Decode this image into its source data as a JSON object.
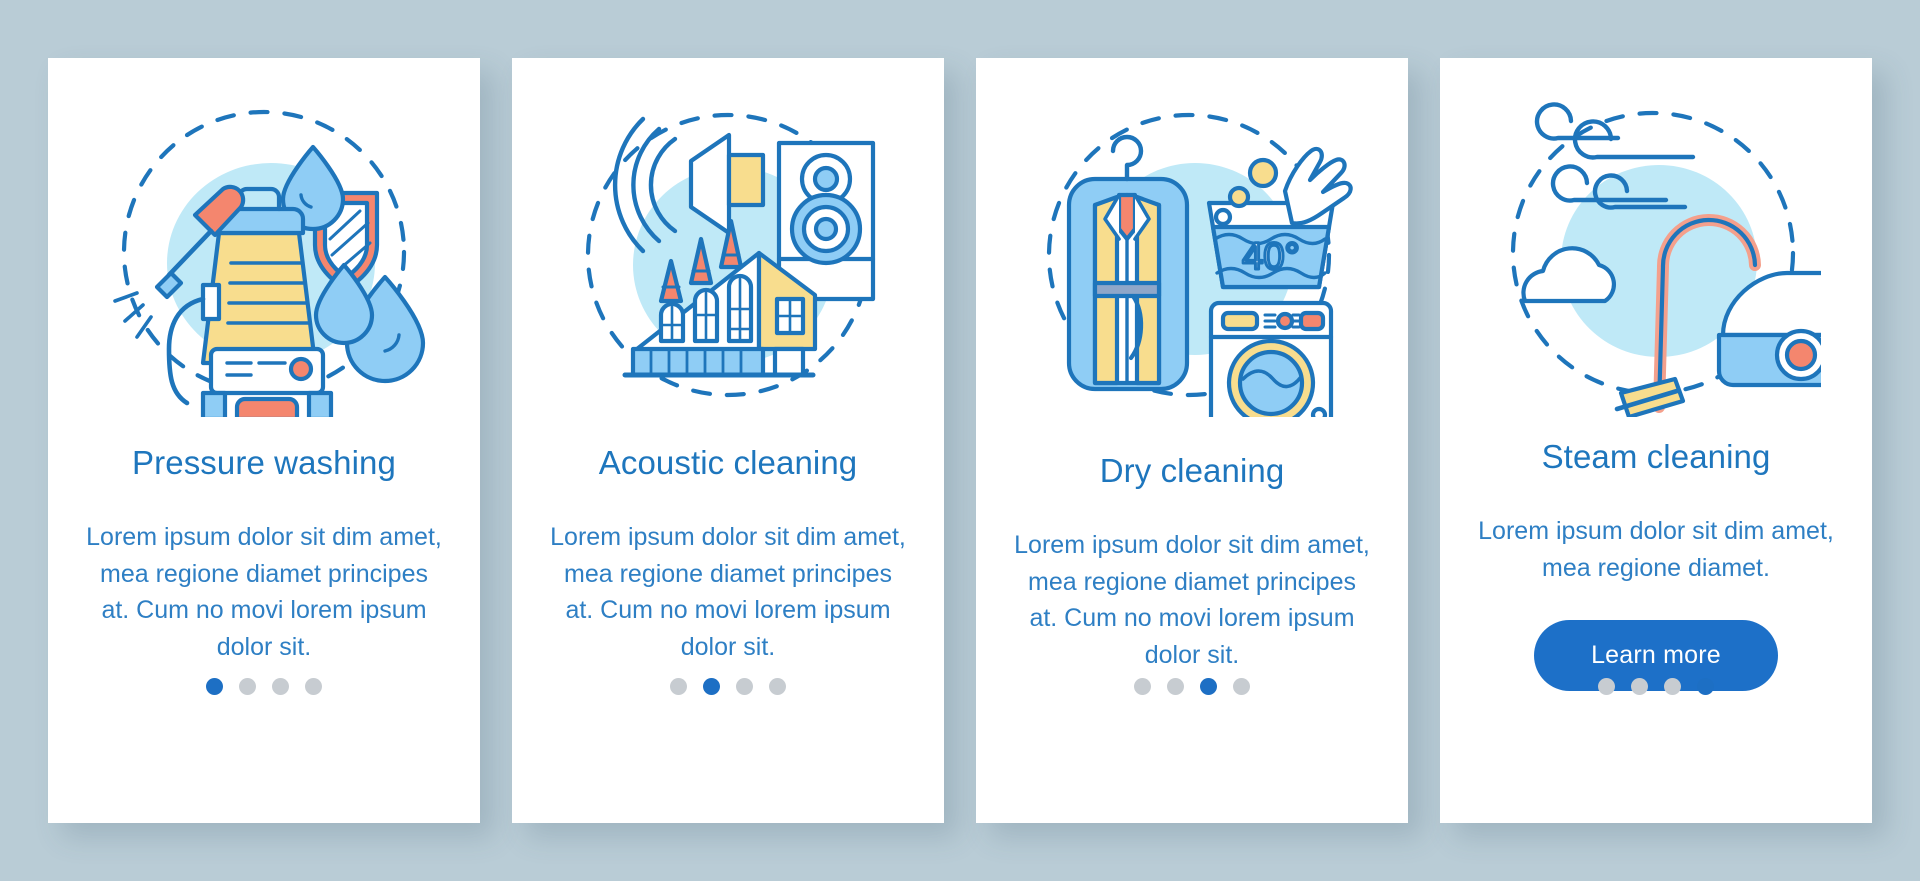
{
  "theme": {
    "page_background": "#b9ccd6",
    "card_background": "#ffffff",
    "title_color": "#1e76bd",
    "body_color": "#2e7fc4",
    "accent_blue": "#1d70c8",
    "dot_active": "#1d6fc4",
    "dot_inactive": "#c7ccd1",
    "illustration_outline": "#1e75bb",
    "illustration_light_blue": "#8fcdf5",
    "illustration_yellow": "#f8dd8e",
    "illustration_coral": "#f4866e",
    "illustration_blob": "#bfe9f7"
  },
  "cards": [
    {
      "id": "pressure-washing",
      "title": "Pressure washing",
      "body": "Lorem ipsum dolor sit dim amet, mea regione diamet principes at. Cum no movi lorem ipsum dolor sit.",
      "illustration_name": "pressure-washer-illustration",
      "dots": {
        "count": 4,
        "active_index": 0
      },
      "has_button": false
    },
    {
      "id": "acoustic-cleaning",
      "title": "Acoustic cleaning",
      "body": "Lorem ipsum dolor sit dim amet, mea regione diamet principes at. Cum no movi lorem ipsum dolor sit.",
      "illustration_name": "acoustic-speaker-building-illustration",
      "dots": {
        "count": 4,
        "active_index": 1
      },
      "has_button": false
    },
    {
      "id": "dry-cleaning",
      "title": "Dry cleaning",
      "body": "Lorem ipsum dolor sit dim amet, mea regione diamet principes at. Cum no movi lorem ipsum dolor sit.",
      "illustration_name": "garment-bag-washing-machine-illustration",
      "illustration_label": "40°",
      "dots": {
        "count": 4,
        "active_index": 2
      },
      "has_button": false
    },
    {
      "id": "steam-cleaning",
      "title": "Steam cleaning",
      "body": "Lorem ipsum dolor sit dim amet, mea regione diamet.",
      "illustration_name": "vacuum-cleaner-steam-illustration",
      "dots": {
        "count": 4,
        "active_index": 3
      },
      "has_button": true,
      "button_label": "Learn more"
    }
  ]
}
